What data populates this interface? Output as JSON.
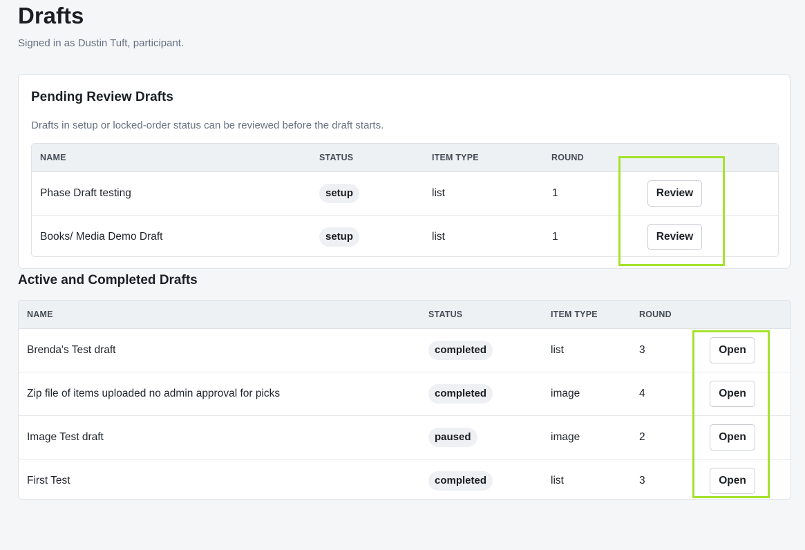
{
  "header": {
    "title": "Drafts",
    "subtitle": "Signed in as Dustin Tuft, participant."
  },
  "pending": {
    "title": "Pending Review Drafts",
    "description": "Drafts in setup or locked-order status can be reviewed before the draft starts.",
    "columns": [
      "NAME",
      "STATUS",
      "ITEM TYPE",
      "ROUND"
    ],
    "rows": [
      {
        "name": "Phase Draft testing",
        "status": "setup",
        "item_type": "list",
        "round": "1",
        "action": "Review"
      },
      {
        "name": "Books/ Media Demo Draft",
        "status": "setup",
        "item_type": "list",
        "round": "1",
        "action": "Review"
      }
    ]
  },
  "active": {
    "title": "Active and Completed Drafts",
    "columns": [
      "NAME",
      "STATUS",
      "ITEM TYPE",
      "ROUND"
    ],
    "rows": [
      {
        "name": "Brenda's Test draft",
        "status": "completed",
        "item_type": "list",
        "round": "3",
        "action": "Open"
      },
      {
        "name": "Zip file of items uploaded no admin approval for picks",
        "status": "completed",
        "item_type": "image",
        "round": "4",
        "action": "Open"
      },
      {
        "name": "Image Test draft",
        "status": "paused",
        "item_type": "image",
        "round": "2",
        "action": "Open"
      },
      {
        "name": "First Test",
        "status": "completed",
        "item_type": "list",
        "round": "3",
        "action": "Open"
      }
    ]
  },
  "colors": {
    "highlight": "#a4e22c",
    "background": "#f5f6f8"
  }
}
